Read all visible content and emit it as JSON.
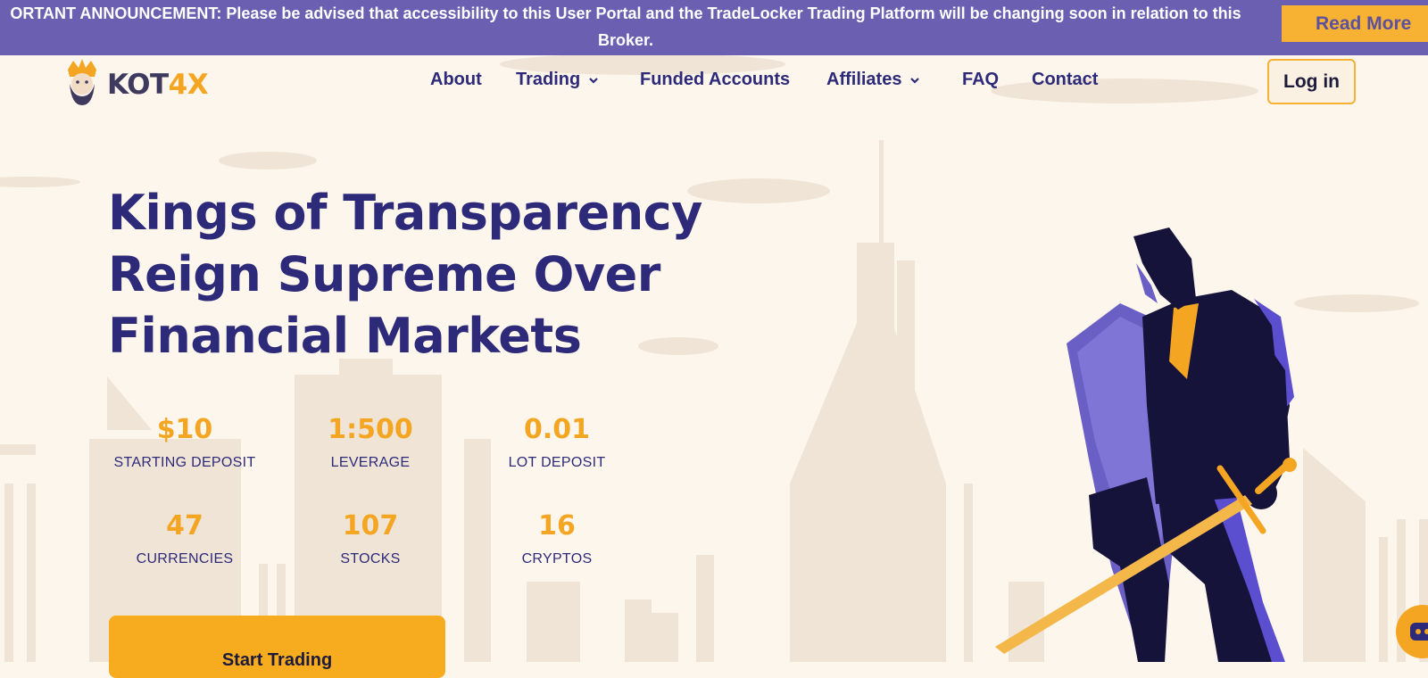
{
  "announcement": {
    "text": "ORTANT ANNOUNCEMENT: Please be advised that accessibility to this User Portal and the TradeLocker Trading Platform will be changing soon in relation to this Broker.",
    "button_label": "Read More"
  },
  "header": {
    "logo_text_main": "KOT",
    "logo_text_accent": "4X",
    "nav": [
      {
        "label": "About",
        "dropdown": false
      },
      {
        "label": "Trading",
        "dropdown": true
      },
      {
        "label": "Funded Accounts",
        "dropdown": false
      },
      {
        "label": "Affiliates",
        "dropdown": true
      },
      {
        "label": "FAQ",
        "dropdown": false
      },
      {
        "label": "Contact",
        "dropdown": false
      }
    ],
    "login_label": "Log in"
  },
  "hero": {
    "title_line1": "Kings of Transparency",
    "title_line2": "Reign Supreme Over",
    "title_line3": "Financial Markets",
    "stats": [
      {
        "value": "$10",
        "label": "STARTING DEPOSIT"
      },
      {
        "value": "1:500",
        "label": "LEVERAGE"
      },
      {
        "value": "0.01",
        "label": "LOT DEPOSIT"
      },
      {
        "value": "47",
        "label": "CURRENCIES"
      },
      {
        "value": "107",
        "label": "STOCKS"
      },
      {
        "value": "16",
        "label": "CRYPTOS"
      }
    ],
    "cta_label": "Start Trading"
  },
  "colors": {
    "accent": "#f4a623",
    "brand_purple": "#2e2a7a",
    "banner": "#6a5fb1",
    "background": "#fdf6ec"
  }
}
